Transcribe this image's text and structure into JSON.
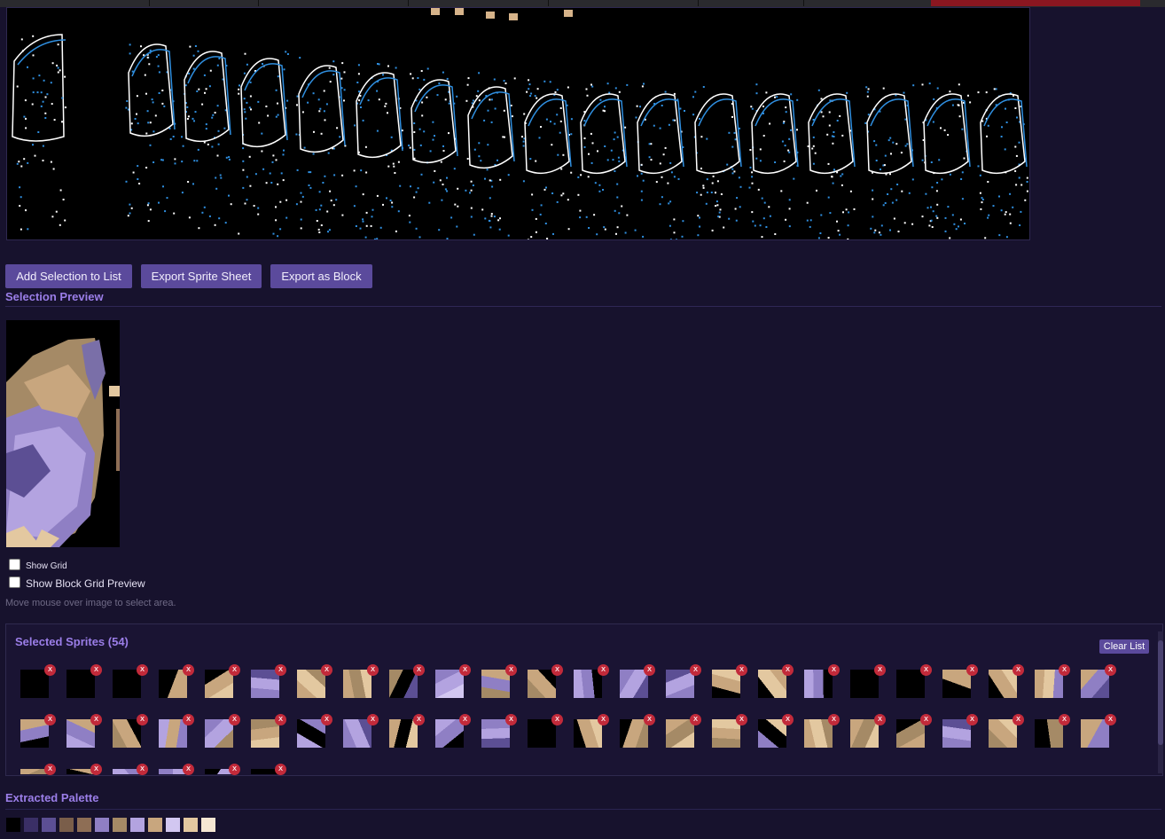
{
  "toolbar": {
    "add_label": "Add Selection to List",
    "export_sheet_label": "Export Sprite Sheet",
    "export_block_label": "Export as Block"
  },
  "preview": {
    "title": "Selection Preview",
    "show_grid_label": "Show Grid",
    "show_block_grid_label": "Show Block Grid Preview",
    "hint": "Move mouse over image to select area."
  },
  "sprites": {
    "title": "Selected Sprites (54)",
    "clear_label": "Clear List",
    "remove_glyph": "x"
  },
  "palette": {
    "title": "Extracted Palette",
    "colors": [
      "#000000",
      "#3a2f66",
      "#5c4f94",
      "#7a5e4a",
      "#8e6e55",
      "#8f7fc4",
      "#a58a66",
      "#b3a3e0",
      "#c8a67e",
      "#d2c7f1",
      "#e3c8a0",
      "#f5e6d2"
    ]
  }
}
